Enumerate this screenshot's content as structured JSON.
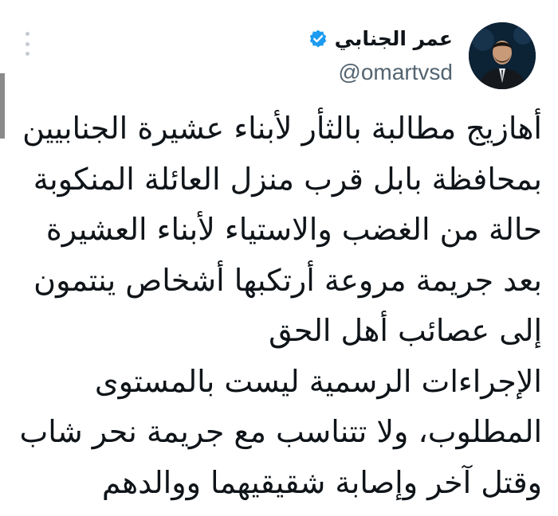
{
  "author": {
    "display_name": "عمر الجنابي",
    "handle": "@omartvsd",
    "verified_icon": "verified-badge-icon",
    "avatar_icon": "profile-photo"
  },
  "more_icon": "more-options-icon",
  "tweet": {
    "lines": [
      "أهازيج مطالبة بالثأر لأبناء عشيرة الجنابيين",
      "بمحافظة بابل قرب منزل العائلة المنكوبة",
      "حالة من الغضب والاستياء لأبناء العشيرة",
      "بعد جريمة مروعة أرتكبها أشخاص ينتمون",
      "إلى عصائب أهل الحق",
      "الإجراءات الرسمية ليست بالمستوى",
      "المطلوب، ولا تتناسب مع جريمة نحر شاب",
      "وقتل آخر وإصابة شقيقيهما ووالدهم"
    ]
  },
  "colors": {
    "verified": "#1d9bf0",
    "text": "#0f1419",
    "secondary_text": "#536471"
  }
}
